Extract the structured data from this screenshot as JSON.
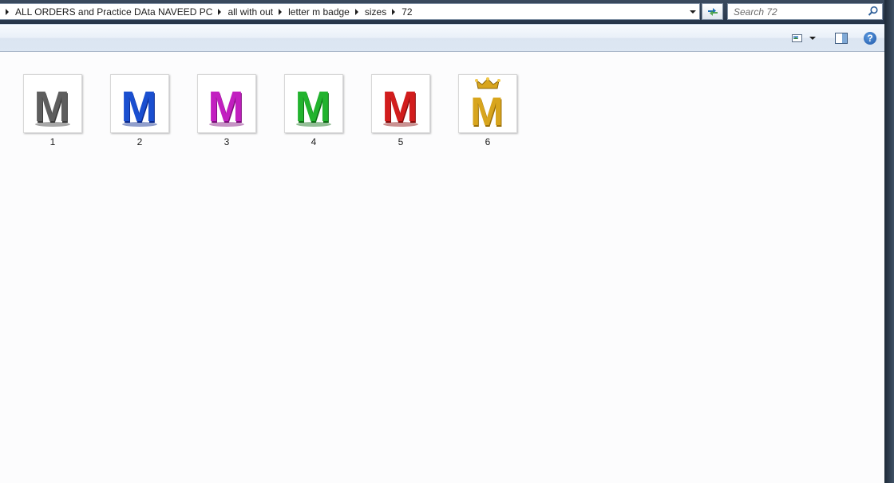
{
  "breadcrumbs": [
    {
      "label": "ALL ORDERS and Practice DAta NAVEED PC"
    },
    {
      "label": "all with out"
    },
    {
      "label": "letter m badge"
    },
    {
      "label": "sizes"
    },
    {
      "label": "72"
    }
  ],
  "search": {
    "placeholder": "Search 72"
  },
  "toolbar": {
    "view_icon": "change-view-icon",
    "preview_icon": "preview-pane-icon",
    "help_icon": "help-icon",
    "help_glyph": "?"
  },
  "files": [
    {
      "name": "1",
      "letter": "M",
      "color": "#5e5e5e",
      "shade": "#3b3b3b",
      "crown": false
    },
    {
      "name": "2",
      "letter": "M",
      "color": "#1a4fd0",
      "shade": "#0b2a8f",
      "crown": false
    },
    {
      "name": "3",
      "letter": "M",
      "color": "#c21fc0",
      "shade": "#7e0f7c",
      "crown": false
    },
    {
      "name": "4",
      "letter": "M",
      "color": "#22b32e",
      "shade": "#0f6f17",
      "crown": false
    },
    {
      "name": "5",
      "letter": "M",
      "color": "#d21d1d",
      "shade": "#8a0d0d",
      "crown": false
    },
    {
      "name": "6",
      "letter": "M",
      "color": "#d8a51d",
      "shade": "#9b700a",
      "crown": true
    }
  ]
}
